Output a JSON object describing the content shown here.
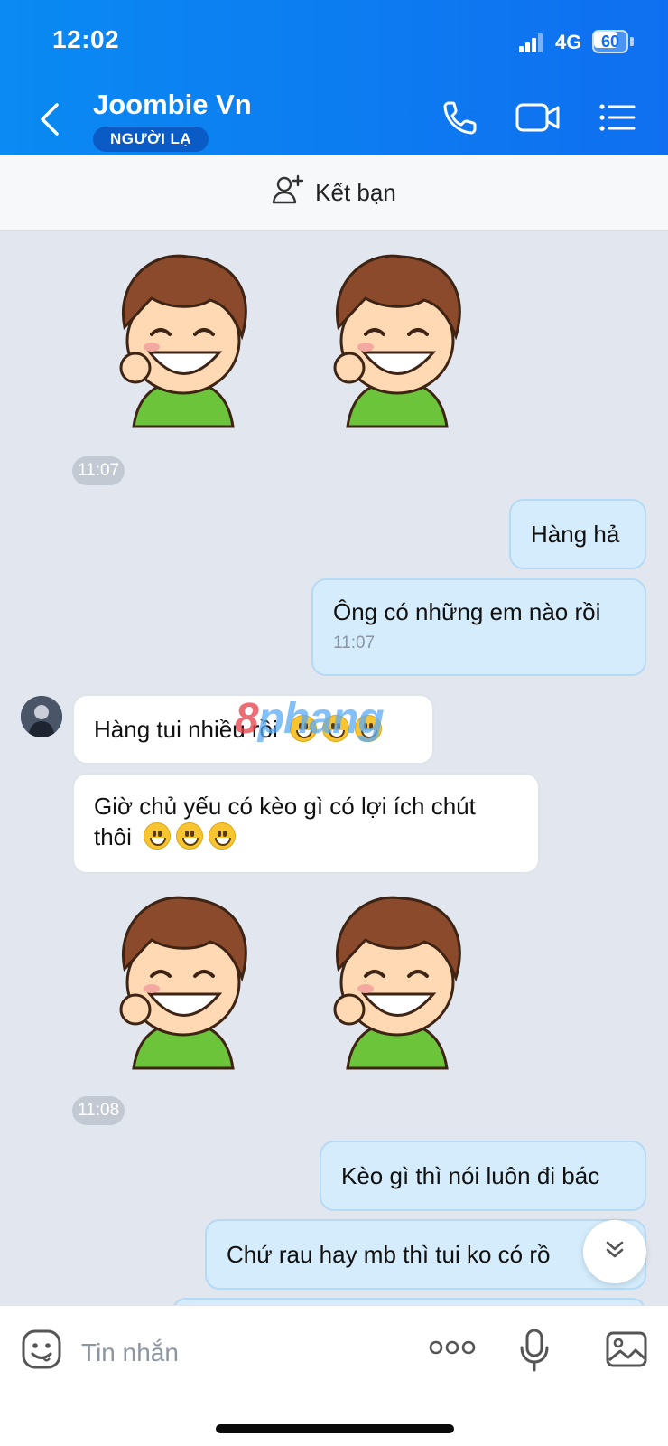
{
  "status_bar": {
    "time": "12:02",
    "network": "4G",
    "battery": "60"
  },
  "header": {
    "name": "Joombie Vn",
    "badge": "NGƯỜI LẠ"
  },
  "friend_bar": {
    "label": "Kết bạn"
  },
  "messages": {
    "time_1": "11:07",
    "out_1": "Hàng hả",
    "out_2": "Ông có những em nào rồi",
    "out_2_time": "11:07",
    "in_1": "Hàng tui nhiều rồi",
    "in_2": "Giờ chủ yếu có kèo gì có lợi ích chút thôi",
    "time_2": "11:08",
    "out_3": "Kèo gì thì nói luôn đi bác",
    "out_4": "Chứ rau hay mb thì tui ko có rồ"
  },
  "watermark": {
    "part1": "8",
    "part2": "phang"
  },
  "composer": {
    "placeholder": "Tin nhắn"
  },
  "colors": {
    "header_blue": "#0f6ff0",
    "out_bubble": "#d4ecfc",
    "in_bubble": "#ffffff",
    "chat_bg": "#e2e7ef"
  },
  "icons": [
    "back-icon",
    "phone-icon",
    "video-call-icon",
    "menu-icon",
    "add-friend-icon",
    "sticker-icon",
    "more-icon",
    "microphone-icon",
    "image-icon",
    "scroll-down-icon"
  ]
}
